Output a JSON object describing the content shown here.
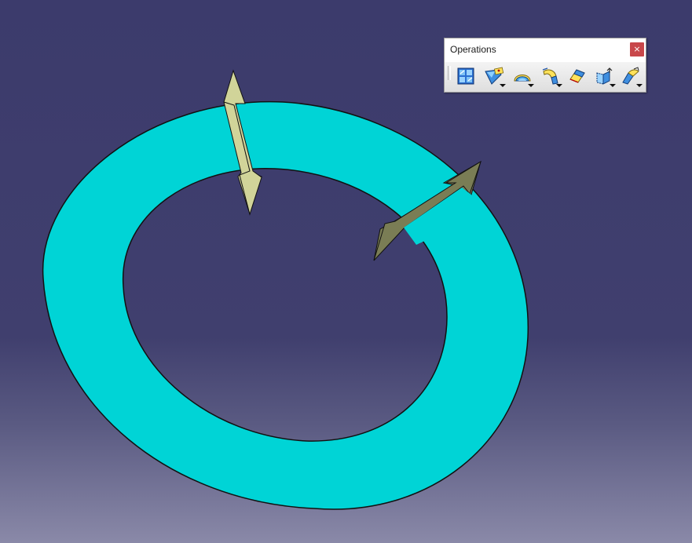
{
  "toolbar": {
    "title": "Operations",
    "close_label": "×",
    "tools": [
      {
        "icon": "join-icon",
        "has_dropdown": false
      },
      {
        "icon": "healing-icon",
        "has_dropdown": true
      },
      {
        "icon": "untrim-icon",
        "has_dropdown": true
      },
      {
        "icon": "split-icon",
        "has_dropdown": true
      },
      {
        "icon": "boundary-icon",
        "has_dropdown": false
      },
      {
        "icon": "extract-icon",
        "has_dropdown": true
      },
      {
        "icon": "fillet-icon",
        "has_dropdown": true
      }
    ]
  },
  "colors": {
    "background_top": "#3c3b6c",
    "background_bottom": "#8a89a8",
    "surface": "#00d4d6",
    "arrow_light": "#d1d499",
    "arrow_dark": "#7a7d55",
    "close_button": "#c8474a"
  }
}
